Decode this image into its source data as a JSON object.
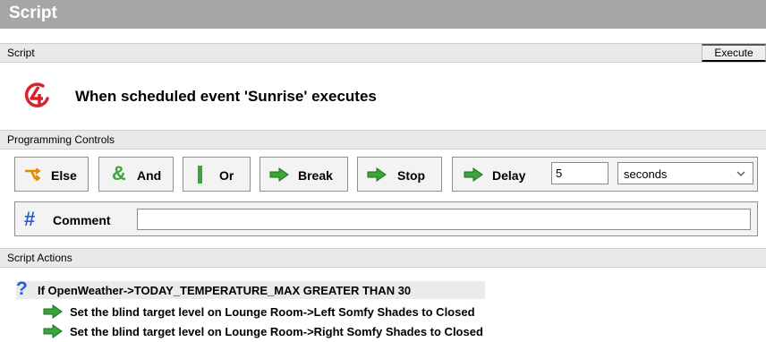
{
  "window": {
    "title": "Script"
  },
  "script_section": {
    "label": "Script",
    "execute_label": "Execute"
  },
  "trigger": {
    "text": "When scheduled event 'Sunrise' executes"
  },
  "programming_controls": {
    "label": "Programming Controls",
    "buttons": [
      {
        "label": "Else",
        "icon": "else-branch-icon"
      },
      {
        "label": "And",
        "icon": "ampersand-icon"
      },
      {
        "label": "Or",
        "icon": "pipe-icon"
      },
      {
        "label": "Break",
        "icon": "green-arrow-icon"
      },
      {
        "label": "Stop",
        "icon": "green-arrow-icon"
      },
      {
        "label": "Delay",
        "icon": "green-arrow-icon"
      }
    ],
    "delay_value": "5",
    "delay_unit": "seconds",
    "comment_label": "Comment",
    "comment_value": ""
  },
  "script_actions": {
    "label": "Script Actions",
    "condition": "If OpenWeather->TODAY_TEMPERATURE_MAX GREATER THAN 30",
    "actions": [
      "Set the blind target level on Lounge Room->Left Somfy Shades to Closed",
      "Set the blind target level on Lounge Room->Right Somfy Shades to Closed"
    ]
  },
  "colors": {
    "title_bar": "#a6a6a6",
    "accent_blue": "#2a5bd6",
    "arrow_green": "#3aa63a",
    "brand_red": "#d9232a"
  }
}
